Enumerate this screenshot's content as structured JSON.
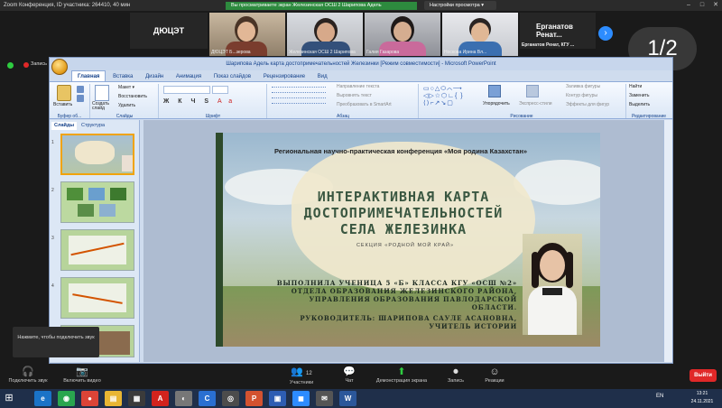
{
  "zoom": {
    "title": "Zoom Конференция, ID участника: 264410, 40 мин",
    "share_banner": "Вы просматриваете экран Железинская ОСШ 2 Шарипова Адель",
    "view_options": "Настройки просмотра ▾",
    "gallery": [
      {
        "kind": "name",
        "text": "ДЮЦЭТ",
        "label": ""
      },
      {
        "kind": "video",
        "label": "ДЮЦЭТ Б...зерова"
      },
      {
        "kind": "video",
        "label": "Железинская ОСШ 2 Шарипова"
      },
      {
        "kind": "video",
        "label": "Галия Газарова"
      },
      {
        "kind": "video",
        "label": "Носкова Ирина Вл..."
      },
      {
        "kind": "name",
        "text": "Ерганатов Ренат...",
        "label": "Ерганатов Ренат, КГУ ..."
      }
    ],
    "page_indicator": "1/2",
    "tooltip": "Нажмите, чтобы подключить звук",
    "toolbar": [
      {
        "icon": "🎧",
        "label": "Подключить звук"
      },
      {
        "icon": "📷",
        "label": "Включить видео"
      },
      {
        "icon": "👥",
        "label": "Участники",
        "badge": "12"
      },
      {
        "icon": "💬",
        "label": "Чат"
      },
      {
        "icon": "⬆",
        "label": "Демонстрация экрана"
      },
      {
        "icon": "⏺",
        "label": "Запись"
      },
      {
        "icon": "☺",
        "label": "Реакции"
      }
    ],
    "leave_label": "Выйти",
    "record_label": "Запись"
  },
  "ppt": {
    "window_title": "Шарипова Адель карта достопримечательностей Железинки [Режим совместимости] - Microsoft PowerPoint",
    "tabs": [
      "Главная",
      "Вставка",
      "Дизайн",
      "Анимация",
      "Показ слайдов",
      "Рецензирование",
      "Вид"
    ],
    "groups": [
      "Буфер об...",
      "Слайды",
      "Шрифт",
      "Абзац",
      "Рисование",
      "Редактирование"
    ],
    "ribbon_items": {
      "paste": "Вставить",
      "new_slide": "Создать слайд",
      "layout": "Макет ▾",
      "reset": "Восстановить",
      "delete": "Удалить",
      "text_dir": "Направление текста",
      "align_text": "Выровнять текст",
      "smartart": "Преобразовать в SmartArt",
      "arrange": "Упорядочить",
      "quick_styles": "Экспресс-стили",
      "fill": "Заливка фигуры",
      "outline": "Контур фигуры",
      "effects": "Эффекты для фигур",
      "find": "Найти",
      "replace": "Заменить",
      "select": "Выделить"
    },
    "panel_tabs": [
      "Слайды",
      "Структура"
    ],
    "thumb_numbers": [
      "1",
      "2",
      "3",
      "4",
      "5"
    ],
    "slide": {
      "conference": "Региональная научно-практическая конференция «Моя родина Казахстан»",
      "title_lines": [
        "ИНТЕРАКТИВНАЯ КАРТА",
        "ДОСТОПРИМЕЧАТЕЛЬНОСТЕЙ",
        "СЕЛА ЖЕЛЕЗИНКА"
      ],
      "subtitle": "СЕКЦИЯ «РОДНОЙ МОЙ КРАЙ»",
      "author_lines": [
        "ВЫПОЛНИЛА УЧЕНИЦА 5 «Б» КЛАССА КГУ «ОСШ №2»",
        "ОТДЕЛА ОБРАЗОВАНИЯ ЖЕЛЕЗИНСКОГО РАЙОНА,",
        "УПРАВЛЕНИЯ ОБРАЗОВАНИЯ ПАВЛОДАРСКОЙ",
        "ОБЛАСТИ.",
        "РУКОВОДИТЕЛЬ: ШАРИПОВА САУЛЕ АСАНОВНА,",
        "УЧИТЕЛЬ ИСТОРИИ"
      ]
    }
  },
  "taskbar": {
    "apps": [
      {
        "glyph": "e",
        "color": "#1a73c7"
      },
      {
        "glyph": "◉",
        "color": "#2aa64f"
      },
      {
        "glyph": "●",
        "color": "#db4437"
      },
      {
        "glyph": "▤",
        "color": "#e8b533"
      },
      {
        "glyph": "▦",
        "color": "#3b3b3b"
      },
      {
        "glyph": "A",
        "color": "#d2231d"
      },
      {
        "glyph": "◐",
        "color": "#777"
      },
      {
        "glyph": "C",
        "color": "#2a6fd1"
      },
      {
        "glyph": "◎",
        "color": "#4c4c4c"
      },
      {
        "glyph": "P",
        "color": "#d35230"
      },
      {
        "glyph": "▣",
        "color": "#2d5db3"
      },
      {
        "glyph": "◼",
        "color": "#2d8cff"
      },
      {
        "glyph": "✉",
        "color": "#555"
      },
      {
        "glyph": "W",
        "color": "#2b579a"
      }
    ],
    "lang": "EN",
    "time": "13:21",
    "date": "24.11.2021"
  }
}
